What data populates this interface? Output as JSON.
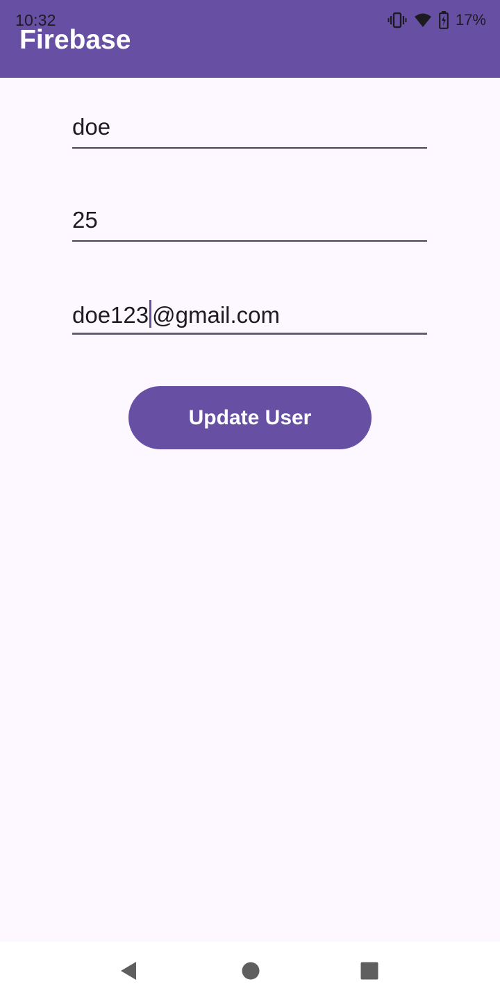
{
  "status_bar": {
    "time": "10:32",
    "battery": "17%",
    "icons": [
      "vibrate-icon",
      "wifi-icon",
      "battery-charging-icon"
    ]
  },
  "app_bar": {
    "title": "Firebase",
    "color": "#6750a4"
  },
  "form": {
    "name_field": {
      "value": "doe"
    },
    "age_field": {
      "value": "25"
    },
    "email_field": {
      "value_before_cursor": "doe123",
      "value_after_cursor": "@gmail.com"
    }
  },
  "update_button": {
    "label": "Update User"
  },
  "nav_bar": {
    "icons": [
      "back-icon",
      "home-icon",
      "recents-icon"
    ]
  },
  "colors": {
    "primary": "#6750a4",
    "background": "#fdf7ff",
    "text": "#1d1b20"
  }
}
